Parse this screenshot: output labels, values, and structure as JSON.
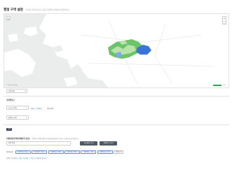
{
  "header": {
    "title": "행정 구역 설정",
    "subtitle": "선택된 지역의 정보는 필요한 영역을 클릭하여 변경합니다."
  },
  "map": {
    "zoom_in": "+",
    "zoom_out": "−",
    "locate": "◎",
    "credit": "© OpenStreetMap",
    "scale": "5 km",
    "colors": {
      "sea": "#ebecec",
      "land": "#ffffff",
      "region_green": "#6cc46a",
      "region_light_green": "#b9e3a8",
      "region_blue": "#3b74d9"
    }
  },
  "filters": {
    "city_select": "지방행정",
    "section1_label": "지방행정구",
    "district_select": "시군구 선택",
    "link_all": "전체 구 선택하기",
    "link_clear": "전체 해제",
    "dong_select": "읍면동 선택"
  },
  "bottom": {
    "chip": "선택",
    "info_title": "지원대상지역(미세먼지 등급)",
    "info_desc": "선택된 지역의 행정구역 정보를 확인하고 필요 시 등록하시기 바랍니다.",
    "input_value": "선택 지역",
    "btn_primary": "지도에서 보기",
    "btn_secondary": "목록으로 보기",
    "tags_label": "선택 지역",
    "tags": [
      "서울특별시 강동구",
      "서울특별시 강북구",
      "서울특별시 관악구",
      "서울특별시 광진구",
      "서울특별시 구로구",
      "서울특별시 금천구"
    ],
    "tag_more": "전체 보기",
    "footnote": "선택한 지역 정보는 행정 구역 변경 시 자동으로 업데이트됩니다."
  }
}
